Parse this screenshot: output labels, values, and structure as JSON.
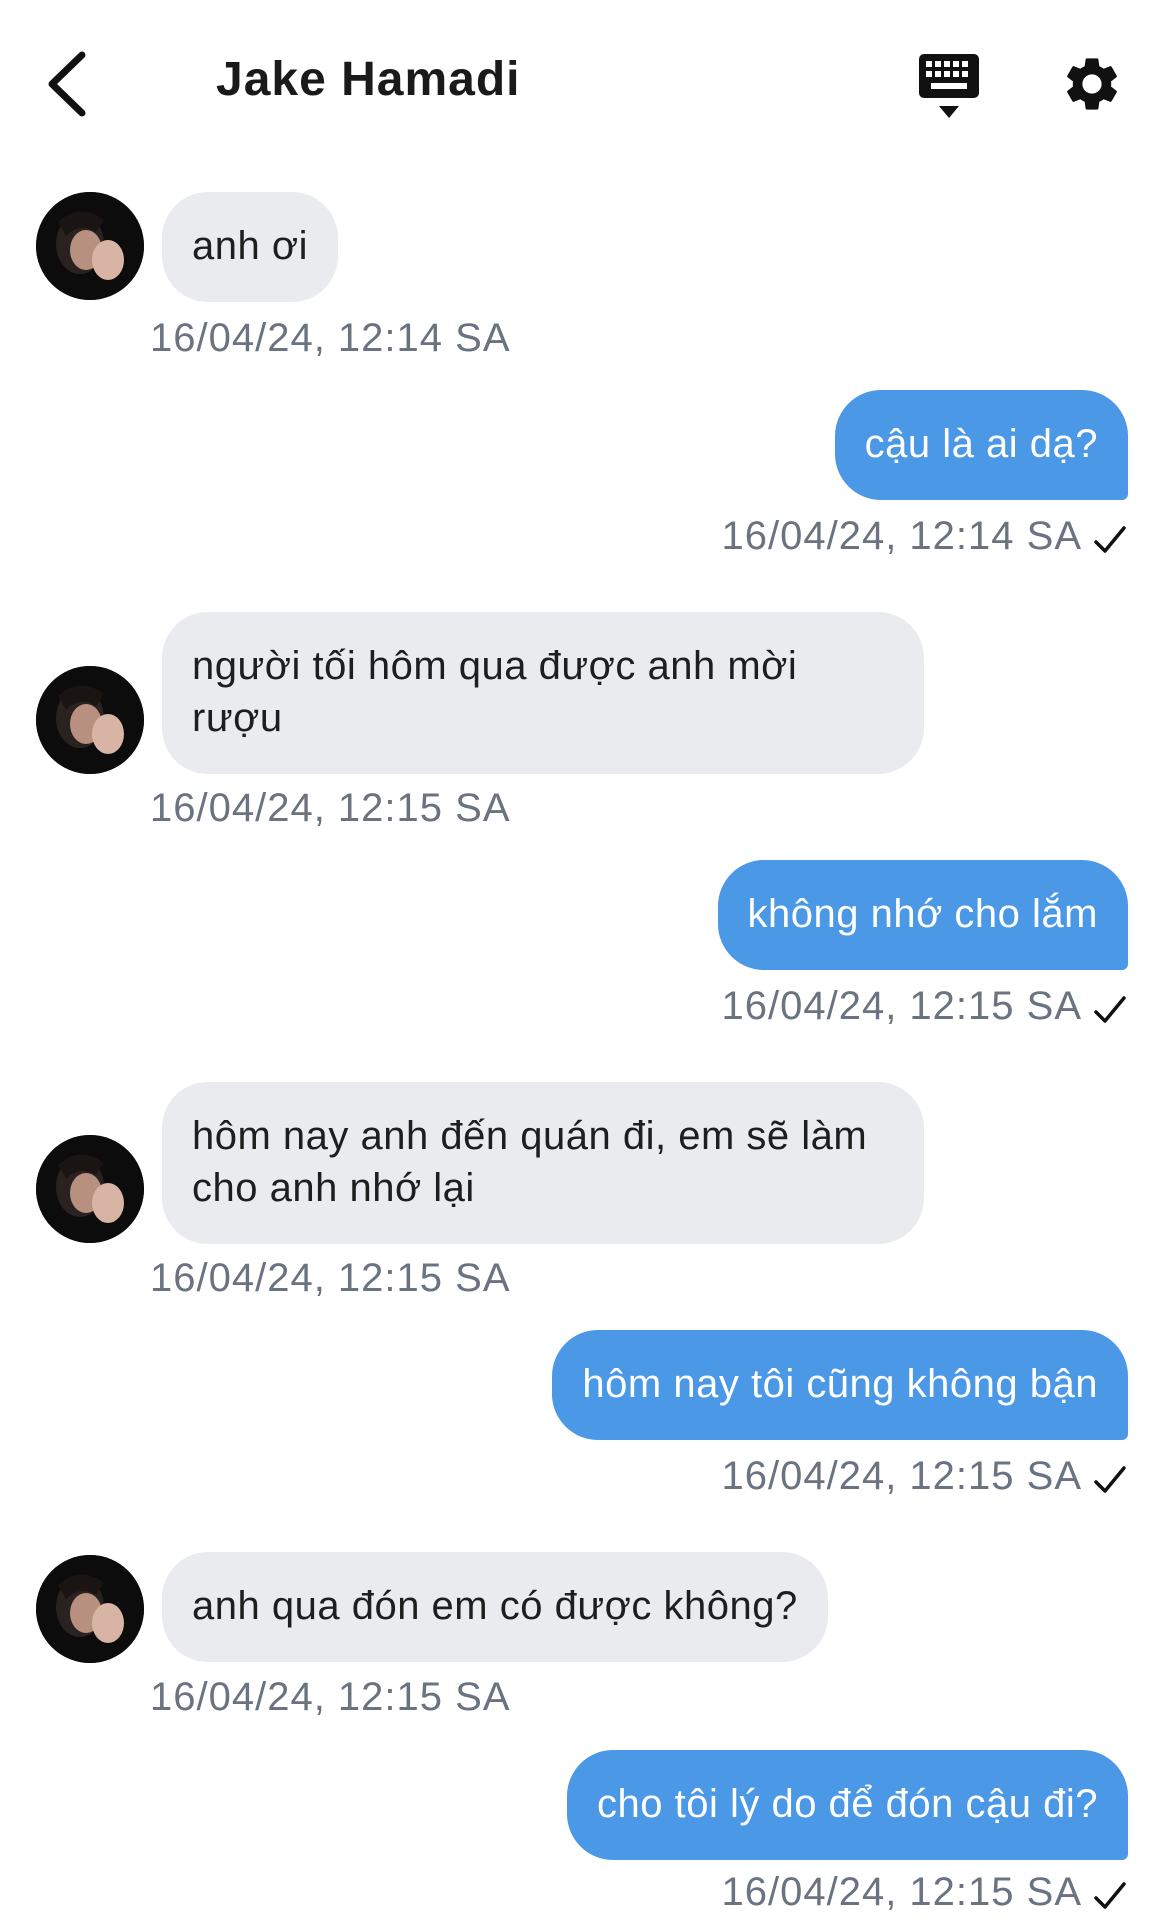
{
  "header": {
    "back_icon": "chevron-left-icon",
    "contact_name": "Jake Hamadi",
    "keyboard_icon": "keyboard-icon",
    "settings_icon": "gear-icon"
  },
  "colors": {
    "incoming_bubble": "#e9ebef",
    "outgoing_bubble": "#4a98e6",
    "timestamp": "#6b7380"
  },
  "messages": [
    {
      "direction": "incoming",
      "text": "anh ơi",
      "time": "16/04/24, 12:14 SA"
    },
    {
      "direction": "outgoing",
      "text": "cậu là ai dạ?",
      "time": "16/04/24, 12:14 SA",
      "status": "sent"
    },
    {
      "direction": "incoming",
      "text": "người tối hôm qua được anh mời rượu",
      "time": "16/04/24, 12:15 SA"
    },
    {
      "direction": "outgoing",
      "text": "không nhớ cho lắm",
      "time": "16/04/24, 12:15 SA",
      "status": "sent"
    },
    {
      "direction": "incoming",
      "text": "hôm nay anh đến quán đi, em sẽ làm cho anh nhớ lại",
      "time": "16/04/24, 12:15 SA"
    },
    {
      "direction": "outgoing",
      "text": "hôm nay tôi cũng không bận",
      "time": "16/04/24, 12:15 SA",
      "status": "sent"
    },
    {
      "direction": "incoming",
      "text": "anh qua đón em có được không?",
      "time": "16/04/24, 12:15 SA"
    },
    {
      "direction": "outgoing",
      "text": "cho tôi lý do để đón cậu đi?",
      "time": "16/04/24, 12:15 SA",
      "status": "sent"
    }
  ]
}
